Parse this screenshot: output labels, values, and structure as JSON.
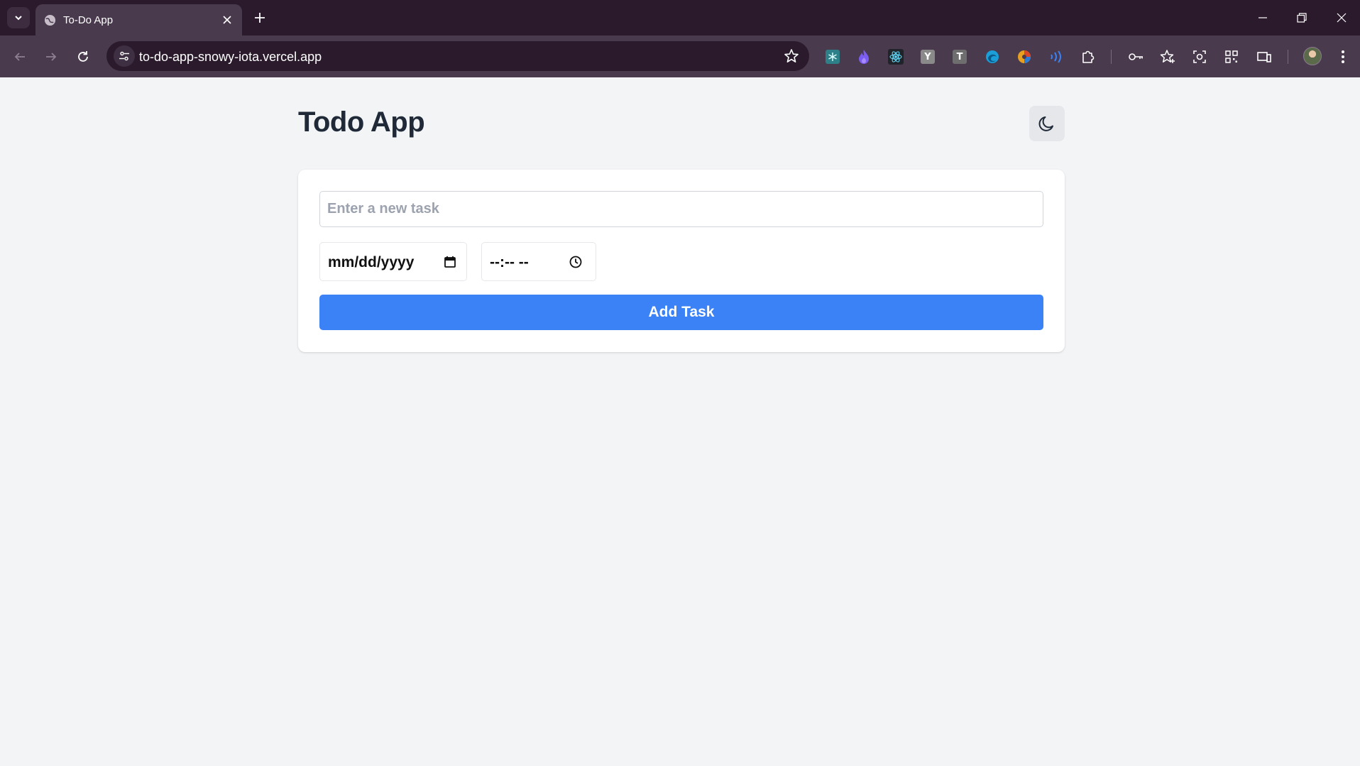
{
  "browser": {
    "tab_title": "To-Do App",
    "url": "to-do-app-snowy-iota.vercel.app",
    "extensions": [
      {
        "name": "snowflake-extension-icon",
        "letter": "",
        "color": "#3a9fa8"
      },
      {
        "name": "flame-extension-icon",
        "letter": "",
        "color": "#7b5cf0"
      },
      {
        "name": "react-devtools-icon",
        "letter": "",
        "color": "#61dafb"
      },
      {
        "name": "y-extension-icon",
        "letter": "Y",
        "color": "#8a8a8a"
      },
      {
        "name": "t-extension-icon",
        "letter": "T",
        "color": "#7a7a7a"
      },
      {
        "name": "edge-extension-icon",
        "letter": "",
        "color": "#1a9fd8"
      },
      {
        "name": "color-extension-icon",
        "letter": "",
        "color": "#e8a020"
      },
      {
        "name": "wave-extension-icon",
        "letter": "",
        "color": "#3b82f6"
      }
    ]
  },
  "app": {
    "title": "Todo App",
    "task_placeholder": "Enter a new task",
    "date_placeholder": "mm/dd/yyyy",
    "time_placeholder": "--:-- --",
    "add_button": "Add Task"
  },
  "colors": {
    "page_background": "#f3f4f6",
    "button_primary": "#3b82f6",
    "title_text": "#1f2937",
    "browser_frame": "#2a1a2c"
  }
}
